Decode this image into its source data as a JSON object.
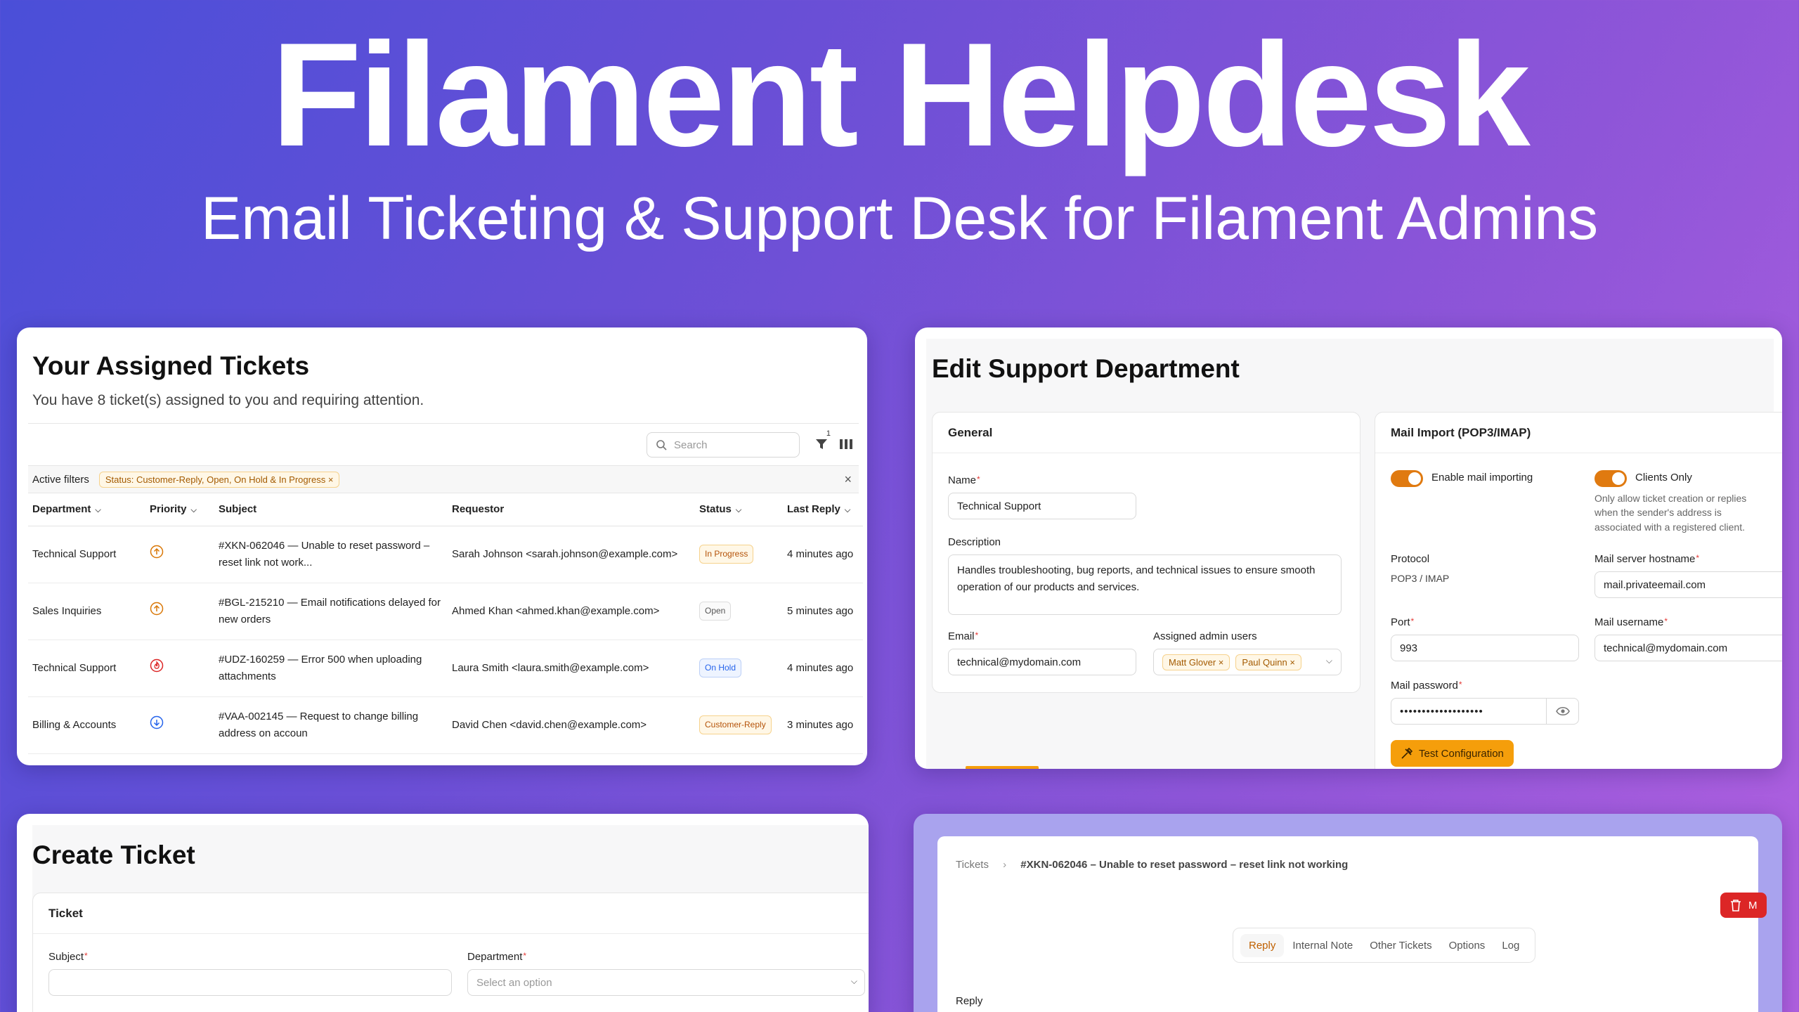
{
  "hero": {
    "title": "Filament Helpdesk",
    "subtitle": "Email Ticketing & Support Desk for Filament Admins"
  },
  "assigned": {
    "title": "Your Assigned Tickets",
    "subtitle": "You have 8 ticket(s) assigned to you and requiring attention.",
    "search_placeholder": "Search",
    "filter_count": "1",
    "active_filters_label": "Active filters",
    "filter_chip": "Status: Customer-Reply, Open, On Hold & In Progress",
    "columns": [
      "Department",
      "Priority",
      "Subject",
      "Requestor",
      "Status",
      "Last Reply"
    ],
    "rows": [
      {
        "department": "Technical Support",
        "priority": "high",
        "subject_l1": "#XKN-062046 — Unable to reset password –",
        "subject_l2": "reset link not work...",
        "requestor": "Sarah Johnson <sarah.johnson@example.com>",
        "status": "In Progress",
        "last_reply": "4 minutes ago"
      },
      {
        "department": "Sales Inquiries",
        "priority": "high",
        "subject_l1": "#BGL-215210 — Email notifications delayed for",
        "subject_l2": "new orders",
        "requestor": "Ahmed Khan <ahmed.khan@example.com>",
        "status": "Open",
        "last_reply": "5 minutes ago"
      },
      {
        "department": "Technical Support",
        "priority": "urgent",
        "subject_l1": "#UDZ-160259 — Error 500 when uploading",
        "subject_l2": "attachments",
        "requestor": "Laura Smith <laura.smith@example.com>",
        "status": "On Hold",
        "last_reply": "4 minutes ago"
      },
      {
        "department": "Billing & Accounts",
        "priority": "low",
        "subject_l1": "#VAA-002145 — Request to change billing",
        "subject_l2": "address on accoun",
        "requestor": "David Chen <david.chen@example.com>",
        "status": "Customer-Reply",
        "last_reply": "3 minutes ago"
      }
    ],
    "colors": {
      "in_progress": "#b45309",
      "open": "#555555",
      "on_hold": "#2563eb",
      "customer_reply": "#b45309",
      "priority_high": "#d97706",
      "priority_urgent": "#dc2626",
      "priority_low": "#2563eb"
    }
  },
  "edit_dept": {
    "title": "Edit Support Department",
    "general": {
      "heading": "General",
      "name_label": "Name",
      "name_value": "Technical Support",
      "desc_label": "Description",
      "desc_value": "Handles troubleshooting, bug reports, and technical issues to ensure smooth operation of our products and services.",
      "email_label": "Email",
      "email_value": "technical@mydomain.com",
      "admins_label": "Assigned admin users",
      "admins": [
        "Matt Glover",
        "Paul Quinn"
      ]
    },
    "mail": {
      "heading": "Mail Import (POP3/IMAP)",
      "enable_label": "Enable mail importing",
      "clients_label": "Clients Only",
      "clients_help": [
        "Only allow ticket creation or replies",
        "when the sender's address is",
        "associated with a registered client."
      ],
      "protocol_label": "Protocol",
      "protocol_value": "POP3 / IMAP",
      "hostname_label": "Mail server hostname",
      "hostname_value": "mail.privateemail.com",
      "port_label": "Port",
      "port_value": "993",
      "username_label": "Mail username",
      "username_value": "technical@mydomain.com",
      "password_label": "Mail password",
      "password_value": "•••••••••••••••••••",
      "test_button": "Test Configuration"
    }
  },
  "create": {
    "title": "Create Ticket",
    "section": "Ticket",
    "subject_label": "Subject",
    "department_label": "Department",
    "department_placeholder": "Select an option"
  },
  "view": {
    "crumb_root": "Tickets",
    "crumb_current": "#XKN-062046 – Unable to reset password – reset link not working",
    "delete_label": "M",
    "tabs": [
      "Reply",
      "Internal Note",
      "Other Tickets",
      "Options",
      "Log"
    ],
    "reply_label": "Reply"
  }
}
